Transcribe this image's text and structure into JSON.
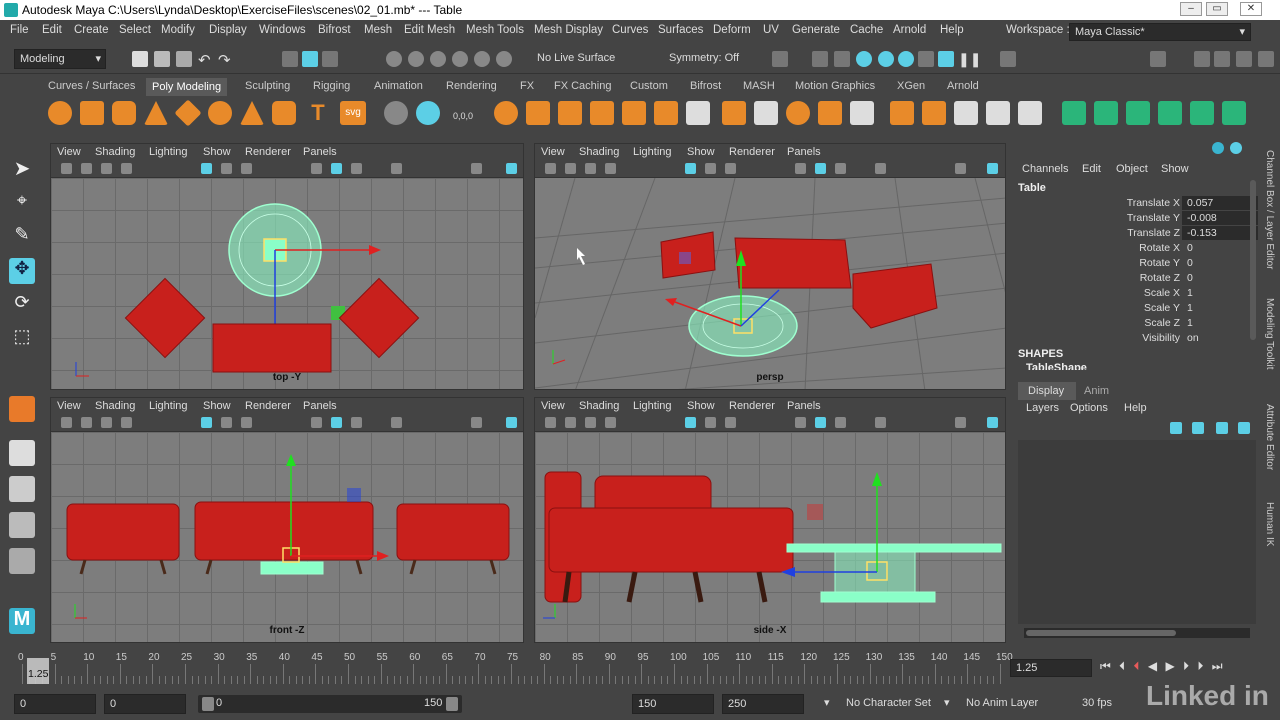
{
  "window": {
    "title": "Autodesk Maya  C:\\Users\\Lynda\\Desktop\\ExerciseFiles\\scenes\\02_01.mb*  ---  Table"
  },
  "menu": [
    "File",
    "Edit",
    "Create",
    "Select",
    "Modify",
    "Display",
    "Windows",
    "Bifrost",
    "Mesh",
    "Edit Mesh",
    "Mesh Tools",
    "Mesh Display",
    "Curves",
    "Surfaces",
    "Deform",
    "UV",
    "Generate",
    "Cache",
    "Arnold",
    "Help"
  ],
  "workspace": {
    "label": "Workspace :",
    "value": "Maya Classic*"
  },
  "status": {
    "mode": "Modeling",
    "live_surface": "No Live Surface",
    "symmetry": "Symmetry: Off"
  },
  "shelf_tabs": [
    "Curves / Surfaces",
    "Poly Modeling",
    "Sculpting",
    "Rigging",
    "Animation",
    "Rendering",
    "FX",
    "FX Caching",
    "Custom",
    "Bifrost",
    "MASH",
    "Motion Graphics",
    "XGen",
    "Arnold"
  ],
  "shelf_active": "Poly Modeling",
  "shelf_text": {
    "text_tool": "T",
    "svg_tool": "svg",
    "coords": "0,0,0"
  },
  "viewport_menu": [
    "View",
    "Shading",
    "Lighting",
    "Show",
    "Renderer",
    "Panels"
  ],
  "viewports": {
    "top": "top -Y",
    "persp": "persp",
    "front": "front -Z",
    "side": "side -X"
  },
  "channel_box": {
    "menu": [
      "Channels",
      "Edit",
      "Object",
      "Show"
    ],
    "object": "Table",
    "attributes": [
      {
        "name": "Translate X",
        "value": "0.057"
      },
      {
        "name": "Translate Y",
        "value": "-0.008"
      },
      {
        "name": "Translate Z",
        "value": "-0.153"
      },
      {
        "name": "Rotate X",
        "value": "0"
      },
      {
        "name": "Rotate Y",
        "value": "0"
      },
      {
        "name": "Rotate Z",
        "value": "0"
      },
      {
        "name": "Scale X",
        "value": "1"
      },
      {
        "name": "Scale Y",
        "value": "1"
      },
      {
        "name": "Scale Z",
        "value": "1"
      },
      {
        "name": "Visibility",
        "value": "on"
      }
    ],
    "shapes_header": "SHAPES",
    "shape_name": "TableShape"
  },
  "layer_editor": {
    "tabs": [
      "Display",
      "Anim"
    ],
    "menu": [
      "Layers",
      "Options",
      "Help"
    ]
  },
  "side_tabs": [
    "Channel Box / Layer Editor",
    "Modeling Toolkit",
    "Attribute Editor",
    "Human IK"
  ],
  "timeline": {
    "ticks": [
      "0",
      "5",
      "10",
      "15",
      "20",
      "25",
      "30",
      "35",
      "40",
      "45",
      "50",
      "55",
      "60",
      "65",
      "70",
      "75",
      "80",
      "85",
      "90",
      "95",
      "100",
      "105",
      "110",
      "115",
      "120",
      "125",
      "130",
      "135",
      "140",
      "145",
      "150"
    ],
    "current": "1.25",
    "current_field": "1.25"
  },
  "range": {
    "start": "0",
    "start_inner": "0",
    "slider_start": "0",
    "slider_end": "150",
    "end_inner": "150",
    "end": "250",
    "character_set": "No Character Set",
    "anim_layer": "No Anim Layer",
    "fps": "30 fps"
  },
  "watermark": "Linked in",
  "colors": {
    "accent": "#5ccfe6",
    "furniture": "#c8201c",
    "selection": "#7fffc0",
    "grid": "#7d7d7d"
  }
}
